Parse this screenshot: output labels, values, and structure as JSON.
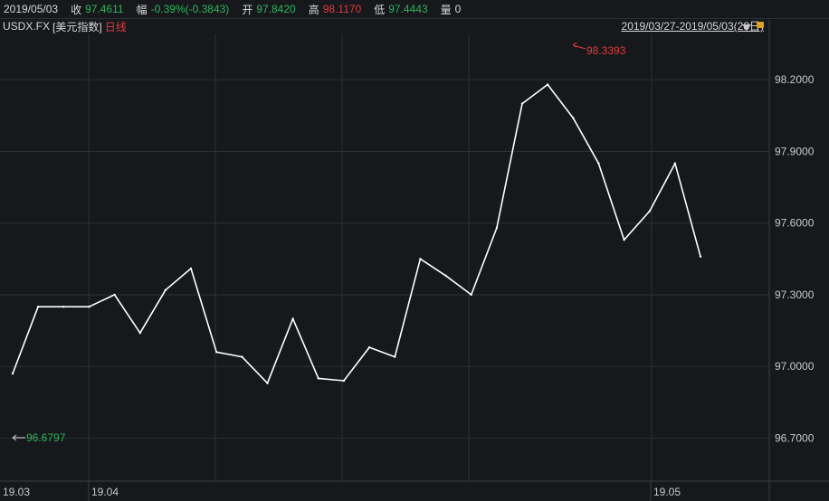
{
  "header": {
    "date": "2019/05/03",
    "close_label": "收",
    "close_value": "97.4611",
    "change_label": "幅",
    "change_value": "-0.39%(-0.3843)",
    "open_label": "开",
    "open_value": "97.8420",
    "high_label": "高",
    "high_value": "98.1170",
    "low_label": "低",
    "low_value": "97.4443",
    "volume_label": "量",
    "volume_value": "0"
  },
  "subheader": {
    "symbol": "USDX.FX",
    "name": "[美元指数]",
    "period": "日线",
    "range": "2019/03/27-2019/05/03(28日)"
  },
  "colors": {
    "up": "#e23b3b",
    "down": "#2fb55a",
    "line": "#ffffff",
    "grid": "#2c2f35",
    "background": "#16181c"
  },
  "icons": [
    "dropdown-triangle-icon",
    "lock-icon"
  ],
  "chart_data": {
    "type": "line",
    "ylim": [
      96.52,
      98.39
    ],
    "y_ticks": [
      "98.2000",
      "97.9000",
      "97.6000",
      "97.3000",
      "97.0000",
      "96.7000"
    ],
    "x_tick_labels": [
      "19.03",
      "19.04",
      "19.05"
    ],
    "annotations": {
      "max_label": "98.3393",
      "min_label": "96.6797"
    },
    "series": [
      {
        "values": [
          96.97,
          97.25,
          97.25,
          97.25,
          97.3,
          97.14,
          97.32,
          97.41,
          97.06,
          97.04,
          96.93,
          97.2,
          96.95,
          96.94,
          97.08,
          97.04,
          97.45,
          97.38,
          97.3,
          97.58,
          98.1,
          98.18,
          98.04,
          97.85,
          97.53,
          97.65,
          97.85,
          97.46
        ]
      }
    ]
  }
}
